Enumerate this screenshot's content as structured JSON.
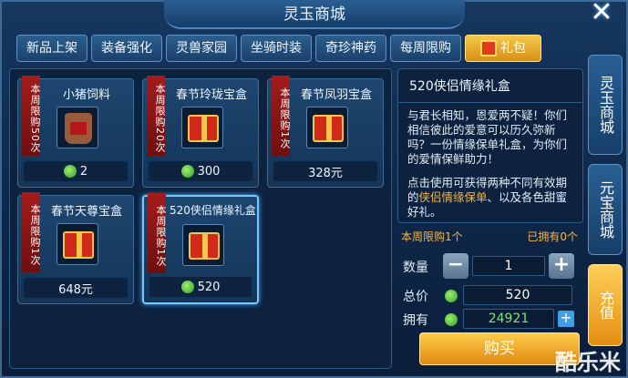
{
  "window": {
    "title": "灵玉商城",
    "close_icon": "close-icon"
  },
  "tabs": [
    {
      "label": "新品上架"
    },
    {
      "label": "装备强化"
    },
    {
      "label": "灵兽家园"
    },
    {
      "label": "坐骑时装"
    },
    {
      "label": "奇珍神药"
    },
    {
      "label": "每周限购"
    },
    {
      "label": "礼包",
      "active": true
    }
  ],
  "items": [
    {
      "name": "小猪饲料",
      "limit": "本周限购50次",
      "price": "2",
      "currency": "green-coin",
      "icon": "feed-bag-icon"
    },
    {
      "name": "春节玲珑宝盒",
      "limit": "本周限购20次",
      "price": "300",
      "currency": "green-coin",
      "icon": "gift-box-icon"
    },
    {
      "name": "春节凤羽宝盒",
      "limit": "本周限购1次",
      "price": "328元",
      "currency": "rmb",
      "icon": "gift-box-icon"
    },
    {
      "name": "春节天尊宝盒",
      "limit": "本周限购1次",
      "price": "648元",
      "currency": "rmb",
      "icon": "gift-box-icon"
    },
    {
      "name": "520侠侣情缘礼盒",
      "limit": "本周限购1次",
      "price": "520",
      "currency": "green-coin",
      "icon": "gift-box-icon",
      "selected": true
    }
  ],
  "detail": {
    "title": "520侠侣情缘礼盒",
    "desc1": "与君长相知，恩爱两不疑！你们相信彼此的爱意可以历久弥新吗？一份情缘保单礼盒，为你们的爱情保鲜助力！",
    "desc2_pre": "点击使用可获得两种不同有效期的",
    "desc2_hl": "侠侣情缘保单",
    "desc2_post": "、以及各色甜蜜好礼。"
  },
  "purchase": {
    "weekly_limit": "本周限购1个",
    "owned_count": "已拥有0个",
    "qty_label": "数量",
    "qty_value": "1",
    "total_label": "总价",
    "total_value": "520",
    "balance_label": "拥有",
    "balance_value": "24921",
    "buy_label": "购买"
  },
  "side_tabs": [
    {
      "label": "灵玉商城"
    },
    {
      "label": "元宝商城"
    },
    {
      "label": "充值"
    }
  ],
  "watermark": "酷乐米",
  "colors": {
    "accent_gold": "#f3b64a",
    "balance_green": "#7fe08a",
    "panel_blue": "#0c223f"
  }
}
